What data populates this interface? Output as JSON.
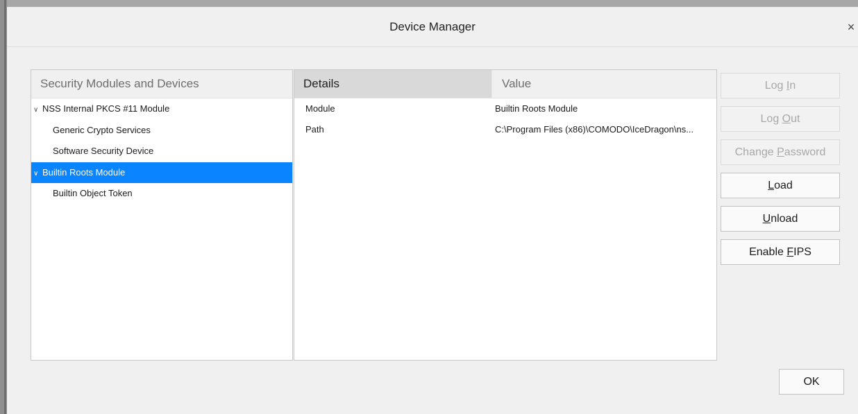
{
  "window": {
    "title": "Device Manager",
    "close_glyph": "×"
  },
  "tree": {
    "header": "Security Modules and Devices",
    "items": [
      {
        "label": "NSS Internal PKCS #11 Module",
        "twisty": "∨"
      },
      {
        "label": "Generic Crypto Services"
      },
      {
        "label": "Software Security Device"
      },
      {
        "label": "Builtin Roots Module",
        "twisty": "∨",
        "selected": true
      },
      {
        "label": "Builtin Object Token"
      }
    ]
  },
  "details": {
    "col_details": "Details",
    "col_value": "Value",
    "rows": [
      {
        "key": "Module",
        "value": "Builtin Roots Module"
      },
      {
        "key": "Path",
        "value": "C:\\Program Files (x86)\\COMODO\\IceDragon\\ns..."
      }
    ]
  },
  "buttons": {
    "login": {
      "pre": "Log ",
      "mn": "I",
      "post": "n"
    },
    "logout": {
      "pre": "Log ",
      "mn": "O",
      "post": "ut"
    },
    "change_password": {
      "pre": "Change ",
      "mn": "P",
      "post": "assword"
    },
    "load": {
      "pre": "",
      "mn": "L",
      "post": "oad"
    },
    "unload": {
      "pre": "",
      "mn": "U",
      "post": "nload"
    },
    "enable_fips": {
      "pre": "Enable ",
      "mn": "F",
      "post": "IPS"
    },
    "ok": "OK"
  },
  "colors": {
    "selection": "#0a84ff",
    "disabled_text": "#a8a8a8"
  },
  "icons": {
    "close": "close-icon",
    "expand": "chevron-down-icon"
  }
}
